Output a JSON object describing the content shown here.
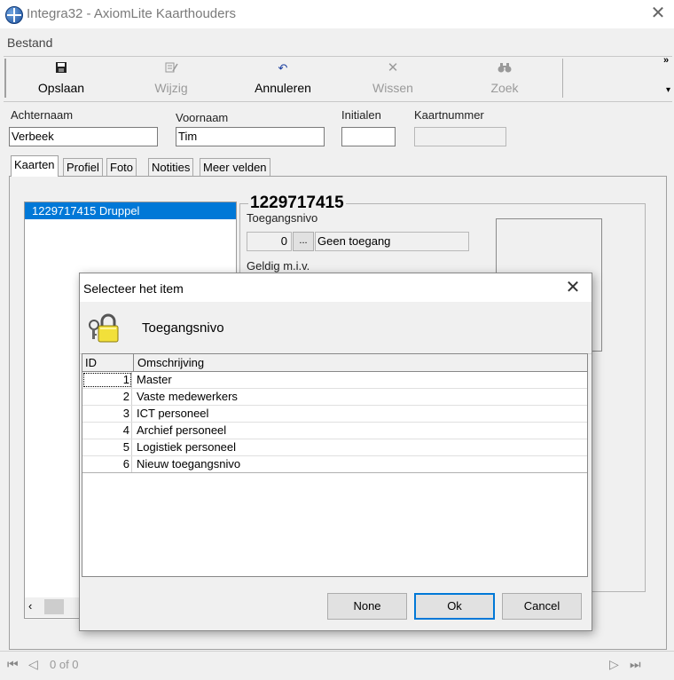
{
  "window": {
    "title": "Integra32 - AxiomLite Kaarthouders"
  },
  "menu": {
    "items": [
      "Bestand"
    ]
  },
  "toolbar": {
    "buttons": [
      {
        "label": "Opslaan",
        "icon": "save-icon",
        "enabled": true
      },
      {
        "label": "Wijzig",
        "icon": "edit-icon",
        "enabled": false
      },
      {
        "label": "Annuleren",
        "icon": "undo-icon",
        "enabled": true
      },
      {
        "label": "Wissen",
        "icon": "delete-icon",
        "enabled": false
      },
      {
        "label": "Zoek",
        "icon": "binoculars-icon",
        "enabled": false
      }
    ],
    "overflow": "»"
  },
  "fields": {
    "achternaam": {
      "label": "Achternaam",
      "value": "Verbeek"
    },
    "voornaam": {
      "label": "Voornaam",
      "value": "Tim"
    },
    "initialen": {
      "label": "Initialen",
      "value": ""
    },
    "kaartnummer": {
      "label": "Kaartnummer",
      "value": ""
    }
  },
  "tabs": [
    "Kaarten",
    "Profiel",
    "Foto",
    "Notities",
    "Meer velden"
  ],
  "cards": {
    "list": [
      "1229717415  Druppel"
    ],
    "selected_title": "1229717415",
    "access_label": "Toegangsnivo",
    "access_id": "0",
    "access_button": "...",
    "access_name": "Geen toegang",
    "valid_label": "Geldig m.i.v."
  },
  "statusbar": {
    "record_text": "0 of 0"
  },
  "dialog": {
    "title": "Selecteer het item",
    "heading": "Toegangsnivo",
    "columns": [
      "ID",
      "Omschrijving"
    ],
    "rows": [
      {
        "id": "1",
        "desc": "Master"
      },
      {
        "id": "2",
        "desc": "Vaste medewerkers"
      },
      {
        "id": "3",
        "desc": "ICT personeel"
      },
      {
        "id": "4",
        "desc": "Archief personeel"
      },
      {
        "id": "5",
        "desc": "Logistiek personeel"
      },
      {
        "id": "6",
        "desc": "Nieuw toegangsnivo"
      }
    ],
    "buttons": {
      "none": "None",
      "ok": "Ok",
      "cancel": "Cancel"
    }
  }
}
